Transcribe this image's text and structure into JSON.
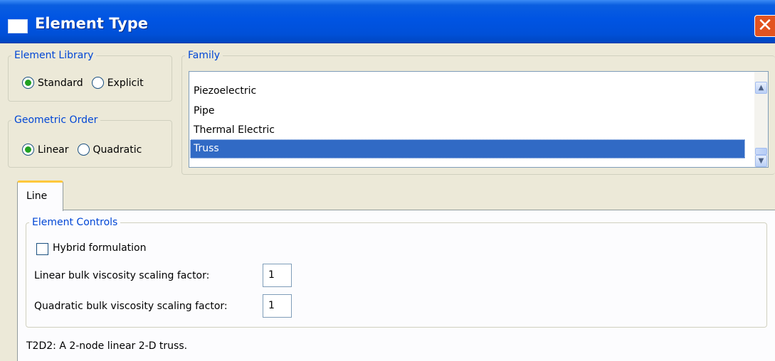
{
  "window": {
    "title": "Element Type",
    "close_label": "✕"
  },
  "element_library": {
    "legend": "Element Library",
    "options": [
      {
        "label": "Standard",
        "selected": true
      },
      {
        "label": "Explicit",
        "selected": false
      }
    ]
  },
  "geometric_order": {
    "legend": "Geometric Order",
    "options": [
      {
        "label": "Linear",
        "selected": true
      },
      {
        "label": "Quadratic",
        "selected": false
      }
    ]
  },
  "family": {
    "legend": "Family",
    "items": [
      "Piezoelectric",
      "Pipe",
      "Thermal Electric",
      "Truss"
    ],
    "selected": "Truss"
  },
  "tabs": [
    {
      "label": "Line",
      "active": true
    }
  ],
  "element_controls": {
    "legend": "Element Controls",
    "hybrid_label": "Hybrid formulation",
    "hybrid_checked": false,
    "linear_label": "Linear bulk viscosity scaling factor:",
    "linear_value": "1",
    "quadratic_label": "Quadratic bulk viscosity scaling factor:",
    "quadratic_value": "1"
  },
  "description": "T2D2:  A 2-node linear 2-D truss.",
  "colors": {
    "title_bar": "#0054e3",
    "selection": "#316ac5",
    "legend_text": "#0046d5",
    "tab_accent": "#ffc83c"
  }
}
